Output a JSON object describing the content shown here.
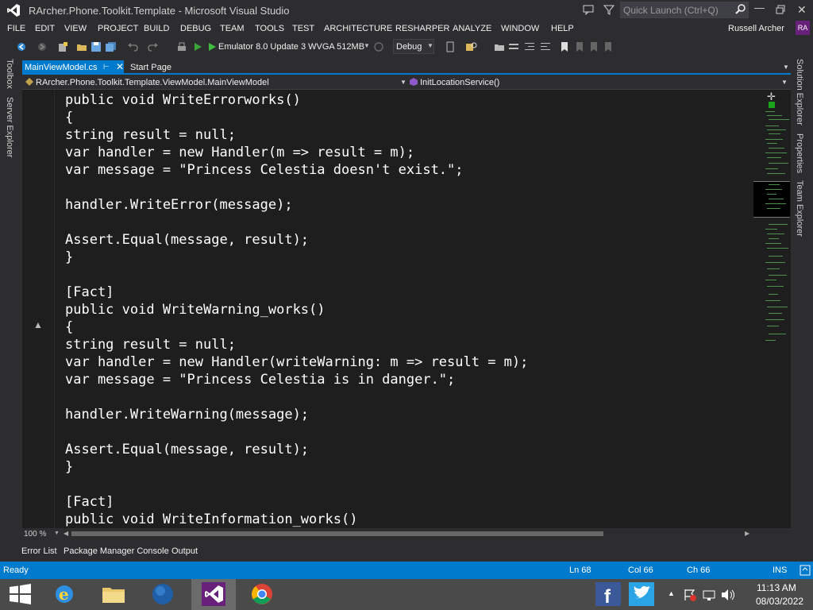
{
  "window": {
    "title": "RArcher.Phone.Toolkit.Template - Microsoft Visual Studio",
    "quick_launch_placeholder": "Quick Launch (Ctrl+Q)"
  },
  "menu": [
    "FILE",
    "EDIT",
    "VIEW",
    "PROJECT",
    "BUILD",
    "DEBUG",
    "TEAM",
    "TOOLS",
    "TEST",
    "ARCHITECTURE",
    "RESHARPER",
    "ANALYZE",
    "WINDOW",
    "HELP"
  ],
  "user": {
    "name": "Russell Archer",
    "initials": "RA"
  },
  "toolbar": {
    "target": "Emulator 8.0 Update 3 WVGA 512MB",
    "configuration": "Debug"
  },
  "side_tabs": {
    "left": [
      "Toolbox",
      "Server Explorer"
    ],
    "right": [
      "Solution Explorer",
      "Properties",
      "Team Explorer"
    ]
  },
  "tabs": [
    {
      "label": "MainViewModel.cs",
      "active": true
    },
    {
      "label": "Start Page",
      "active": false
    }
  ],
  "navbar": {
    "type": "RArcher.Phone.Toolkit.Template.ViewModel.MainViewModel",
    "member": "InitLocationService()"
  },
  "code_lines": [
    "public void WriteErrorworks()",
    "{",
    "string result = null;",
    "var handler = new Handler(m => result = m);",
    "var message = \"Princess Celestia doesn't exist.\";",
    "",
    "handler.WriteError(message);",
    "",
    "Assert.Equal(message, result);",
    "}",
    "",
    "[Fact]",
    "public void WriteWarning_works()",
    "{",
    "string result = null;",
    "var handler = new Handler(writeWarning: m => result = m);",
    "var message = \"Princess Celestia is in danger.\";",
    "",
    "handler.WriteWarning(message);",
    "",
    "Assert.Equal(message, result);",
    "}",
    "",
    "[Fact]",
    "public void WriteInformation_works()"
  ],
  "zoom": "100 %",
  "bottom_tabs": [
    "Error List",
    "Package Manager Console",
    "Output"
  ],
  "status": {
    "text": "Ready",
    "line": "Ln 68",
    "col": "Col 66",
    "ch": "Ch 66",
    "mode": "INS"
  },
  "taskbar": {
    "icons": [
      "windows-start-icon",
      "internet-explorer-icon",
      "file-explorer-icon",
      "globe-icon",
      "visual-studio-icon",
      "chrome-icon",
      "facebook-icon",
      "twitter-icon"
    ],
    "time": "11:13 AM",
    "date": "08/03/2022"
  },
  "colors": {
    "accent": "#007acc",
    "editor_bg": "#1e1e1e",
    "chrome_bg": "#2d2d30",
    "vs_purple": "#68217a"
  }
}
